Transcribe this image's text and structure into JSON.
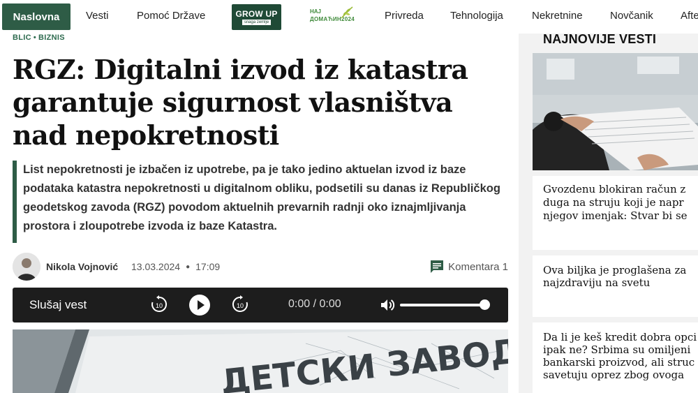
{
  "nav": {
    "home": "Naslovna",
    "links": [
      "Vesti",
      "Pomoć Države",
      "Privreda",
      "Tehnologija",
      "Nekretnine",
      "Novčanik",
      "Afte"
    ],
    "growup_title": "GROW UP",
    "growup_sub": "snaga zemlje",
    "najdomacije_top": "НАЈ",
    "najdomacije_bottom": "ДОМАЋИН2024",
    "brand_color": "#2e5c46"
  },
  "article": {
    "breadcrumb": [
      "BLIC",
      "BIZNIS"
    ],
    "title": "RGZ: Digitalni izvod iz katastra garantuje sigurnost vlasništva nad nepokretnosti",
    "lead": "List nepokretnosti je izbačen iz upotrebe, pa je tako jedino aktuelan izvod iz baze podataka katastra nepokretnosti u digitalnom obliku, podsetili su danas iz Republičkog geodetskog zavoda (RGZ) povodom aktuelnih prevarnih radnji oko iznajmljivanja prostora i zloupotrebe izvoda iz baze Katastra.",
    "author": "Nikola Vojnović",
    "date": "13.03.2024",
    "time": "17:09",
    "comments_label": "Komentara 1"
  },
  "player": {
    "label": "Slušaj vest",
    "skip_seconds": "10",
    "time": "0:00 / 0:00",
    "volume": 1.0
  },
  "sidebar": {
    "heading": "NAJNOVIJE VESTI",
    "items": [
      {
        "lines": [
          "Gvozdenu blokiran račun z",
          "duga na struju koji je napr",
          "njegov imenjak: Stvar bi se"
        ]
      },
      {
        "lines": [
          "Ova biljka je proglašena za",
          "najzdraviju na svetu"
        ]
      },
      {
        "lines": [
          "Da li je keš kredit dobra opci",
          "ipak ne? Srbima su omiljeni",
          "bankarski proizvod, ali struc",
          "savetuju oprez zbog ovoga"
        ]
      }
    ]
  }
}
